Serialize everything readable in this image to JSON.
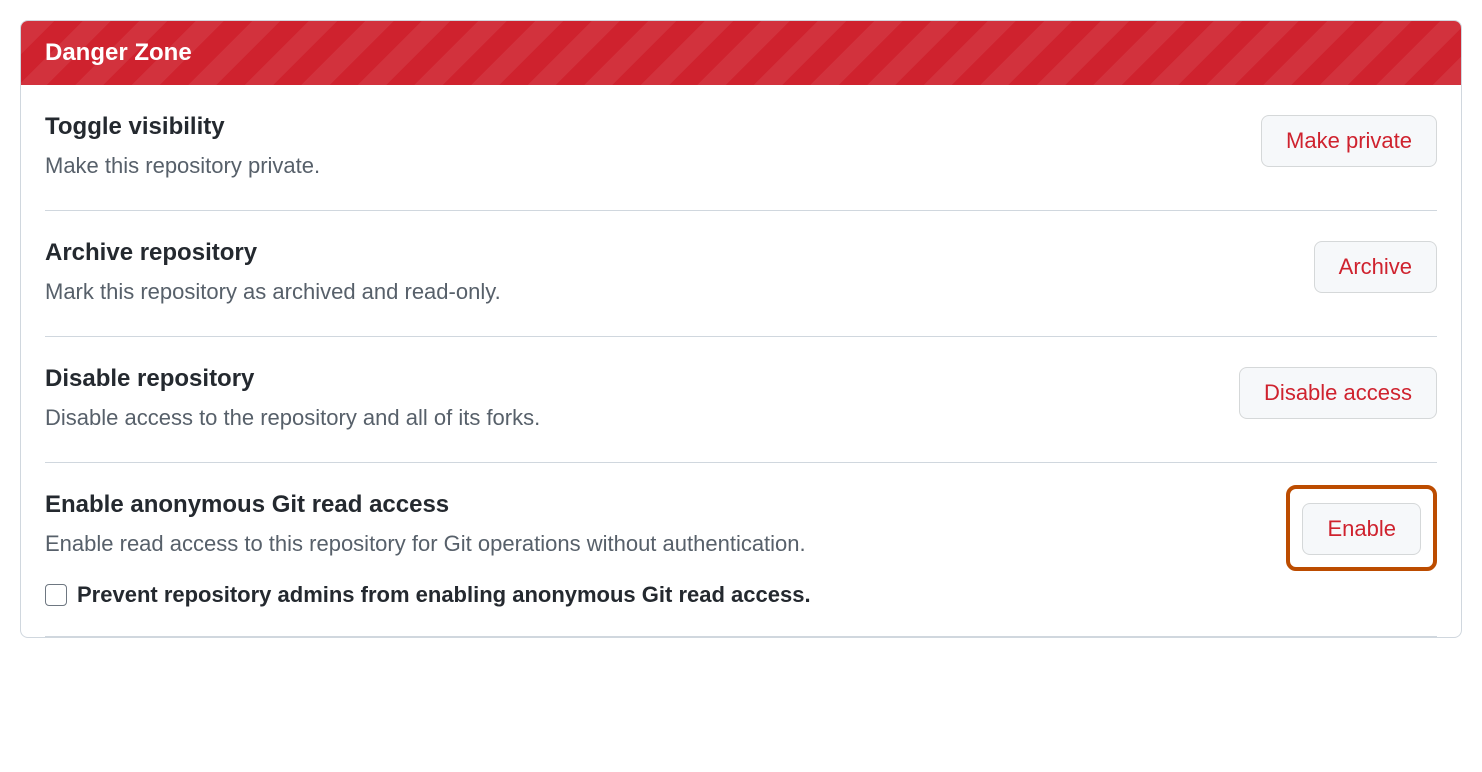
{
  "header": {
    "title": "Danger Zone"
  },
  "rows": {
    "visibility": {
      "title": "Toggle visibility",
      "desc": "Make this repository private.",
      "button": "Make private"
    },
    "archive": {
      "title": "Archive repository",
      "desc": "Mark this repository as archived and read-only.",
      "button": "Archive"
    },
    "disable": {
      "title": "Disable repository",
      "desc": "Disable access to the repository and all of its forks.",
      "button": "Disable access"
    },
    "anon": {
      "title": "Enable anonymous Git read access",
      "desc": "Enable read access to this repository for Git operations without authentication.",
      "button": "Enable",
      "checkbox_label": "Prevent repository admins from enabling anonymous Git read access."
    }
  }
}
